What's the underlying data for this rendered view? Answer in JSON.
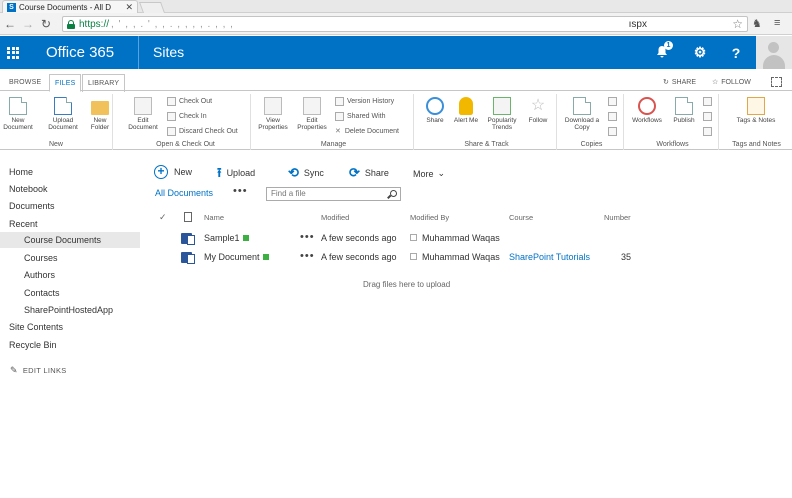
{
  "browser": {
    "tab_title": "Course Documents - All D",
    "tab_favicon": "S",
    "url_scheme": "https://",
    "url_hidden": ",  '  ,    ,  .   ' , ,  . ,  ,  ,  , .   ,  ,  ,",
    "url_end": "ıspx"
  },
  "suitebar": {
    "brand": "Office 365",
    "app": "Sites",
    "notification_count": "1",
    "help_label": "?"
  },
  "ribbon_tabs": {
    "browse": "BROWSE",
    "files": "FILES",
    "library": "LIBRARY",
    "share": "SHARE",
    "follow": "FOLLOW"
  },
  "ribbon": {
    "new_group": {
      "label": "New",
      "new_document": "New Document",
      "upload_document": "Upload Document",
      "new_folder": "New Folder"
    },
    "checkout_group": {
      "label": "Open & Check Out",
      "edit_document": "Edit Document",
      "check_out": "Check Out",
      "check_in": "Check In",
      "discard_check_out": "Discard Check Out"
    },
    "manage_group": {
      "label": "Manage",
      "view_properties": "View Properties",
      "edit_properties": "Edit Properties",
      "version_history": "Version History",
      "shared_with": "Shared With",
      "delete_document": "Delete Document"
    },
    "share_group": {
      "label": "Share & Track",
      "share": "Share",
      "alert_me": "Alert Me",
      "popularity_trends": "Popularity Trends",
      "follow": "Follow"
    },
    "copies_group": {
      "label": "Copies",
      "download_copy": "Download a Copy"
    },
    "workflows_group": {
      "label": "Workflows",
      "workflows": "Workflows",
      "publish": "Publish"
    },
    "tags_group": {
      "label": "Tags and Notes",
      "tags_notes": "Tags & Notes"
    }
  },
  "leftnav": {
    "home": "Home",
    "notebook": "Notebook",
    "documents": "Documents",
    "recent": "Recent",
    "course_documents": "Course Documents",
    "courses": "Courses",
    "authors": "Authors",
    "contacts": "Contacts",
    "hosted_app": "SharePointHostedApp",
    "site_contents": "Site Contents",
    "recycle_bin": "Recycle Bin",
    "edit_links": "EDIT LINKS"
  },
  "commands": {
    "new": "New",
    "upload": "Upload",
    "sync": "Sync",
    "share": "Share",
    "more": "More"
  },
  "view": {
    "label": "All Documents",
    "ellipsis": "•••",
    "search_placeholder": "Find a file"
  },
  "table": {
    "headers": {
      "name": "Name",
      "modified": "Modified",
      "modified_by": "Modified By",
      "course": "Course",
      "number": "Number"
    },
    "rows": [
      {
        "name": "Sample1",
        "modified": "A few seconds ago",
        "modified_by": "Muhammad Waqas",
        "course": "",
        "number": ""
      },
      {
        "name": "My Document",
        "modified": "A few seconds ago",
        "modified_by": "Muhammad Waqas",
        "course": "SharePoint Tutorials",
        "number": "35"
      }
    ],
    "row_ellipsis": "•••"
  },
  "drag_hint": "Drag files here to upload",
  "colors": {
    "suitebar": "#0072c6",
    "link": "#0072c6",
    "selected_nav": "#e8e8e8"
  }
}
